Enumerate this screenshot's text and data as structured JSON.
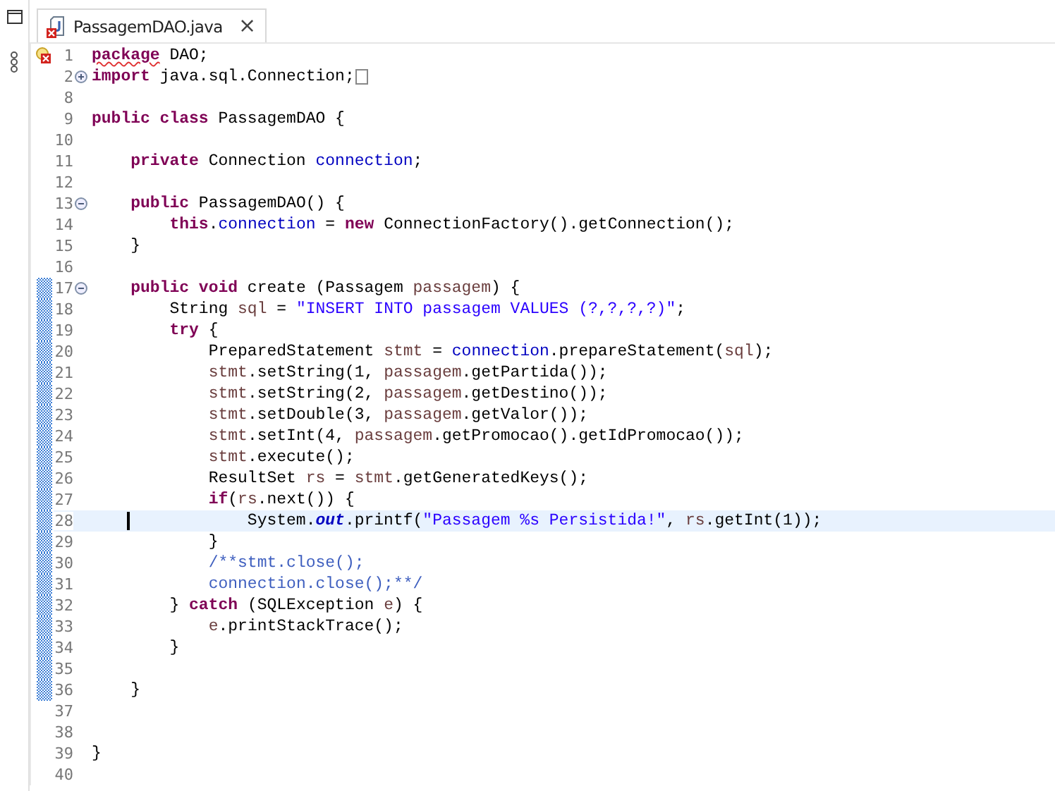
{
  "tab": {
    "title": "PassagemDAO.java",
    "close": "×",
    "selected": true,
    "error": true
  },
  "lines": [
    {
      "number": "1",
      "error": true,
      "range": false,
      "current": false,
      "segments": [
        {
          "text": "package",
          "kind": "keyword",
          "squiggle": true
        },
        {
          "text": " DAO;",
          "kind": "plain"
        }
      ]
    },
    {
      "number": "2",
      "folded": true,
      "range": false,
      "current": false,
      "folded_box": true,
      "segments": [
        {
          "text": "import",
          "kind": "keyword"
        },
        {
          "text": " java.sql.Connection;",
          "kind": "plain"
        }
      ]
    },
    {
      "number": "8",
      "range": false,
      "current": false
    },
    {
      "number": "9",
      "range": false,
      "current": false,
      "segments": [
        {
          "text": "public class",
          "kind": "keyword"
        },
        {
          "text": " PassagemDAO {",
          "kind": "plain"
        }
      ]
    },
    {
      "number": "10",
      "range": false,
      "current": false
    },
    {
      "number": "11",
      "range": false,
      "current": false,
      "segments": [
        {
          "text": "    private",
          "kind": "keyword"
        },
        {
          "text": " Connection ",
          "kind": "plain"
        },
        {
          "text": "connection",
          "kind": "field"
        },
        {
          "text": ";",
          "kind": "plain"
        }
      ]
    },
    {
      "number": "12",
      "range": false,
      "current": false
    },
    {
      "number": "13",
      "folded": false,
      "range": false,
      "current": false,
      "segments": [
        {
          "text": "    public",
          "kind": "keyword"
        },
        {
          "text": " PassagemDAO() {",
          "kind": "plain"
        }
      ]
    },
    {
      "number": "14",
      "range": false,
      "current": false,
      "segments": [
        {
          "text": "        this",
          "kind": "keyword"
        },
        {
          "text": ".",
          "kind": "plain"
        },
        {
          "text": "connection",
          "kind": "field"
        },
        {
          "text": " = ",
          "kind": "plain"
        },
        {
          "text": "new",
          "kind": "keyword"
        },
        {
          "text": " ConnectionFactory().getConnection();",
          "kind": "plain"
        }
      ]
    },
    {
      "number": "15",
      "range": false,
      "current": false,
      "segments": [
        {
          "text": "    }",
          "kind": "plain"
        }
      ]
    },
    {
      "number": "16",
      "range": false,
      "current": false
    },
    {
      "number": "17",
      "folded": false,
      "range": true,
      "current": false,
      "segments": [
        {
          "text": "    public void",
          "kind": "keyword"
        },
        {
          "text": " create (Passagem ",
          "kind": "plain"
        },
        {
          "text": "passagem",
          "kind": "local"
        },
        {
          "text": ") {",
          "kind": "plain"
        }
      ]
    },
    {
      "number": "18",
      "range": true,
      "current": false,
      "segments": [
        {
          "text": "        String ",
          "kind": "plain"
        },
        {
          "text": "sql",
          "kind": "local"
        },
        {
          "text": " = ",
          "kind": "plain"
        },
        {
          "text": "\"INSERT INTO passagem VALUES (?,?,?,?)\"",
          "kind": "string"
        },
        {
          "text": ";",
          "kind": "plain"
        }
      ]
    },
    {
      "number": "19",
      "range": true,
      "current": false,
      "segments": [
        {
          "text": "        try",
          "kind": "keyword"
        },
        {
          "text": " {",
          "kind": "plain"
        }
      ]
    },
    {
      "number": "20",
      "range": true,
      "current": false,
      "segments": [
        {
          "text": "            PreparedStatement ",
          "kind": "plain"
        },
        {
          "text": "stmt",
          "kind": "local"
        },
        {
          "text": " = ",
          "kind": "plain"
        },
        {
          "text": "connection",
          "kind": "field"
        },
        {
          "text": ".prepareStatement(",
          "kind": "plain"
        },
        {
          "text": "sql",
          "kind": "local"
        },
        {
          "text": ");",
          "kind": "plain"
        }
      ]
    },
    {
      "number": "21",
      "range": true,
      "current": false,
      "segments": [
        {
          "text": "            stmt",
          "kind": "local"
        },
        {
          "text": ".setString(1, ",
          "kind": "plain"
        },
        {
          "text": "passagem",
          "kind": "local"
        },
        {
          "text": ".getPartida());",
          "kind": "plain"
        }
      ]
    },
    {
      "number": "22",
      "range": true,
      "current": false,
      "segments": [
        {
          "text": "            stmt",
          "kind": "local"
        },
        {
          "text": ".setString(2, ",
          "kind": "plain"
        },
        {
          "text": "passagem",
          "kind": "local"
        },
        {
          "text": ".getDestino());",
          "kind": "plain"
        }
      ]
    },
    {
      "number": "23",
      "range": true,
      "current": false,
      "segments": [
        {
          "text": "            stmt",
          "kind": "local"
        },
        {
          "text": ".setDouble(3, ",
          "kind": "plain"
        },
        {
          "text": "passagem",
          "kind": "local"
        },
        {
          "text": ".getValor());",
          "kind": "plain"
        }
      ]
    },
    {
      "number": "24",
      "range": true,
      "current": false,
      "segments": [
        {
          "text": "            stmt",
          "kind": "local"
        },
        {
          "text": ".setInt(4, ",
          "kind": "plain"
        },
        {
          "text": "passagem",
          "kind": "local"
        },
        {
          "text": ".getPromocao().getIdPromocao());",
          "kind": "plain"
        }
      ]
    },
    {
      "number": "25",
      "range": true,
      "current": false,
      "segments": [
        {
          "text": "            stmt",
          "kind": "local"
        },
        {
          "text": ".execute();",
          "kind": "plain"
        }
      ]
    },
    {
      "number": "26",
      "range": true,
      "current": false,
      "segments": [
        {
          "text": "            ResultSet ",
          "kind": "plain"
        },
        {
          "text": "rs",
          "kind": "local"
        },
        {
          "text": " = ",
          "kind": "plain"
        },
        {
          "text": "stmt",
          "kind": "local"
        },
        {
          "text": ".getGeneratedKeys();",
          "kind": "plain"
        }
      ]
    },
    {
      "number": "27",
      "range": true,
      "current": false,
      "segments": [
        {
          "text": "            if",
          "kind": "keyword"
        },
        {
          "text": "(",
          "kind": "plain"
        },
        {
          "text": "rs",
          "kind": "local"
        },
        {
          "text": ".next()) {",
          "kind": "plain"
        }
      ]
    },
    {
      "number": "28",
      "range": true,
      "current": true,
      "segments": [
        {
          "text": "                System.",
          "kind": "plain"
        },
        {
          "text": "out",
          "kind": "static"
        },
        {
          "text": ".printf(",
          "kind": "plain"
        },
        {
          "text": "\"Passagem %s Persistida!\"",
          "kind": "string"
        },
        {
          "text": ", ",
          "kind": "plain"
        },
        {
          "text": "rs",
          "kind": "local"
        },
        {
          "text": ".getInt(1));",
          "kind": "plain"
        }
      ]
    },
    {
      "number": "29",
      "range": true,
      "current": false,
      "segments": [
        {
          "text": "            }",
          "kind": "plain"
        }
      ]
    },
    {
      "number": "30",
      "range": true,
      "current": false,
      "segments": [
        {
          "text": "            /**stmt.close();",
          "kind": "comment"
        }
      ]
    },
    {
      "number": "31",
      "range": true,
      "current": false,
      "segments": [
        {
          "text": "            connection.close();**/",
          "kind": "comment"
        }
      ]
    },
    {
      "number": "32",
      "range": true,
      "current": false,
      "segments": [
        {
          "text": "        } ",
          "kind": "plain"
        },
        {
          "text": "catch",
          "kind": "keyword"
        },
        {
          "text": " (SQLException ",
          "kind": "plain"
        },
        {
          "text": "e",
          "kind": "local"
        },
        {
          "text": ") {",
          "kind": "plain"
        }
      ]
    },
    {
      "number": "33",
      "range": true,
      "current": false,
      "segments": [
        {
          "text": "            e",
          "kind": "local"
        },
        {
          "text": ".printStackTrace();",
          "kind": "plain"
        }
      ]
    },
    {
      "number": "34",
      "range": true,
      "current": false,
      "segments": [
        {
          "text": "        }",
          "kind": "plain"
        }
      ]
    },
    {
      "number": "35",
      "range": true,
      "current": false
    },
    {
      "number": "36",
      "range": true,
      "current": false,
      "segments": [
        {
          "text": "    }",
          "kind": "plain"
        }
      ]
    },
    {
      "number": "37",
      "range": false,
      "current": false
    },
    {
      "number": "38",
      "range": false,
      "current": false
    },
    {
      "number": "39",
      "range": false,
      "current": false,
      "segments": [
        {
          "text": "}",
          "kind": "plain"
        }
      ]
    },
    {
      "number": "40",
      "range": false,
      "current": false
    }
  ]
}
